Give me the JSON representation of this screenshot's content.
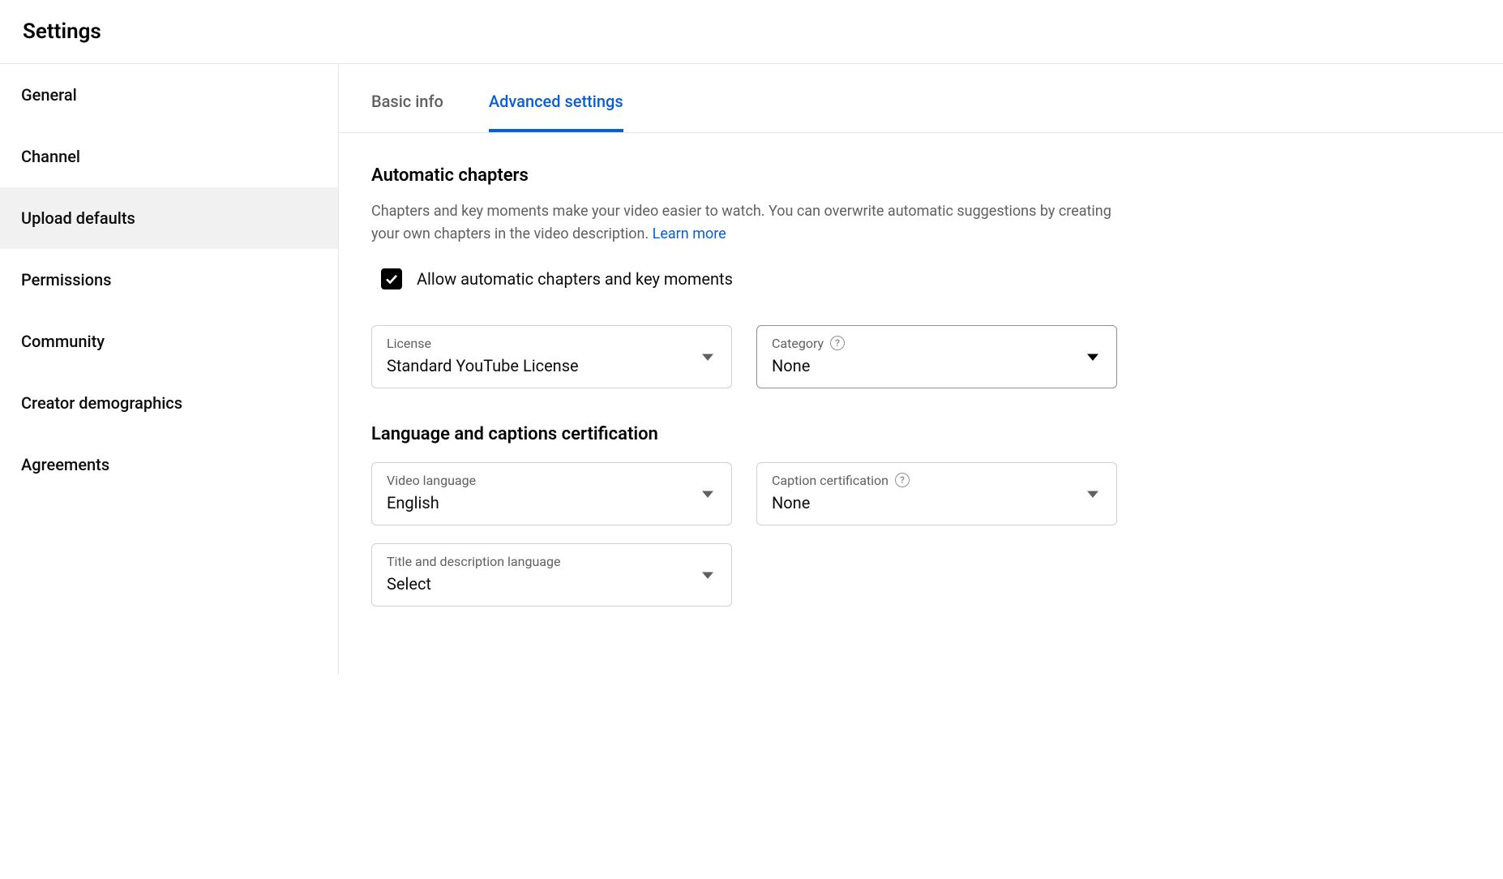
{
  "header": {
    "title": "Settings"
  },
  "sidebar": {
    "items": [
      {
        "label": "General"
      },
      {
        "label": "Channel"
      },
      {
        "label": "Upload defaults"
      },
      {
        "label": "Permissions"
      },
      {
        "label": "Community"
      },
      {
        "label": "Creator demographics"
      },
      {
        "label": "Agreements"
      }
    ],
    "activeIndex": 2
  },
  "tabs": {
    "items": [
      {
        "label": "Basic info"
      },
      {
        "label": "Advanced settings"
      }
    ],
    "activeIndex": 1
  },
  "automaticChapters": {
    "title": "Automatic chapters",
    "description": "Chapters and key moments make your video easier to watch. You can overwrite automatic suggestions by creating your own chapters in the video description. ",
    "learnMore": "Learn more",
    "checkboxLabel": "Allow automatic chapters and key moments",
    "checked": true
  },
  "selects": {
    "license": {
      "label": "License",
      "value": "Standard YouTube License"
    },
    "category": {
      "label": "Category",
      "value": "None"
    },
    "language": {
      "title": "Language and captions certification",
      "video": {
        "label": "Video language",
        "value": "English"
      },
      "caption": {
        "label": "Caption certification",
        "value": "None"
      },
      "title_desc": {
        "label": "Title and description language",
        "value": "Select"
      }
    }
  }
}
